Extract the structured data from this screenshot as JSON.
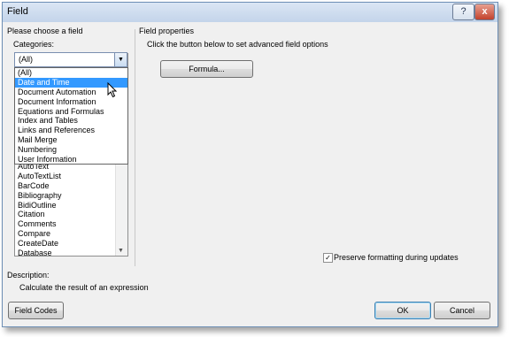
{
  "window": {
    "title": "Field",
    "help_label": "?",
    "close_label": "x"
  },
  "left": {
    "heading": "Please choose a field",
    "categories_label": "Categories:",
    "categories_value": "(All)",
    "dropdown_options": [
      "(All)",
      "Date and Time",
      "Document Automation",
      "Document Information",
      "Equations and Formulas",
      "Index and Tables",
      "Links and References",
      "Mail Merge",
      "Numbering",
      "User Information"
    ],
    "selected_option": "Date and Time",
    "field_names": [
      "AutoText",
      "AutoTextList",
      "BarCode",
      "Bibliography",
      "BidiOutline",
      "Citation",
      "Comments",
      "Compare",
      "CreateDate",
      "Database"
    ]
  },
  "right": {
    "heading": "Field properties",
    "instruction": "Click the button below to set advanced field options",
    "formula_button": "Formula...",
    "preserve_label": "Preserve formatting during updates",
    "preserve_checked": true
  },
  "description": {
    "label": "Description:",
    "text": "Calculate the result of an expression"
  },
  "buttons": {
    "field_codes": "Field Codes",
    "ok": "OK",
    "cancel": "Cancel"
  }
}
